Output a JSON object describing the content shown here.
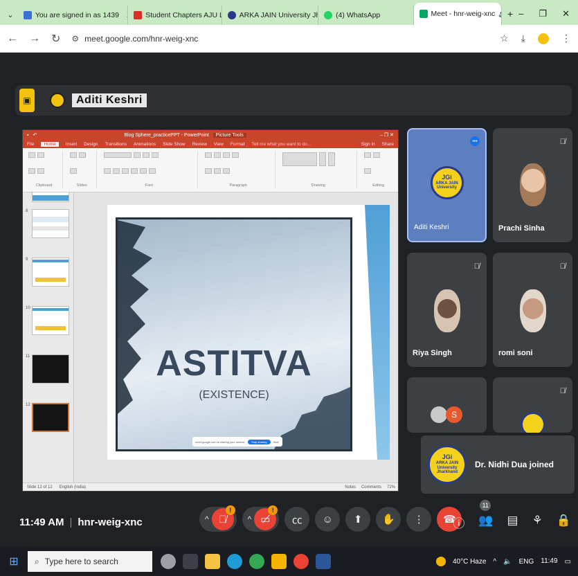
{
  "browser": {
    "tabs": [
      {
        "title": "You are signed in as 1439",
        "color": "#3a6fd8"
      },
      {
        "title": "Student Chapters AJU Logo",
        "color": "#d93025"
      },
      {
        "title": "ARKA JAIN University Jharkh",
        "color": "#2a3a8a"
      },
      {
        "title": "(4) WhatsApp",
        "color": "#25d366"
      },
      {
        "title": "Meet - hnr-weig-xnc",
        "color": "#00a862"
      }
    ],
    "tab_close": "X",
    "tab_new": "+",
    "url": "meet.google.com/hnr-weig-xnc"
  },
  "presenter": {
    "name": "Aditi Keshri"
  },
  "ppt": {
    "window_title": "Blog Sphere_practicePPT - PowerPoint",
    "context_tab": "Picture Tools",
    "menu": [
      "File",
      "Home",
      "Insert",
      "Design",
      "Transitions",
      "Animations",
      "Slide Show",
      "Review",
      "View",
      "Format"
    ],
    "tell_me": "Tell me what you want to do...",
    "sign_in": "Sign in",
    "share": "Share",
    "ribbon_groups": [
      "Clipboard",
      "Slides",
      "Font",
      "Paragraph",
      "Drawing",
      "Editing"
    ],
    "slide_numbers": [
      "8",
      "9",
      "10",
      "11",
      "12"
    ],
    "slide_title": "ASTITVA",
    "slide_subtitle": "(EXISTENCE)",
    "status_left": "Slide 12 of 12",
    "status_lang": "English (India)",
    "status_notes": "Notes",
    "status_comments": "Comments",
    "zoom": "72%",
    "sharing_toast": "meet.google.com is sharing your screen.",
    "stop_sharing": "Stop sharing",
    "hide": "Hide"
  },
  "tiles": [
    {
      "name": "Aditi Keshri",
      "kind": "logo",
      "active": true
    },
    {
      "name": "Prachi Sinha",
      "kind": "photo-a",
      "muted": true
    },
    {
      "name": "Riya Singh",
      "kind": "photo-b",
      "muted": true
    },
    {
      "name": "romi soni",
      "kind": "photo-c",
      "muted": true
    }
  ],
  "more_tile_initial": "S",
  "logo_text": {
    "mark": "JGi",
    "line1": "ARKA JAIN",
    "line2": "University",
    "line3": "Jharkhand"
  },
  "join_notice": "Dr. Nidhi Dua joined",
  "controls": {
    "time": "11:49 AM",
    "meeting_code": "hnr-weig-xnc",
    "people_count": "11",
    "warn": "!"
  },
  "taskbar": {
    "search_placeholder": "Type here to search",
    "weather": "40°C  Haze",
    "lang": "ENG",
    "time": "11:49"
  },
  "colors": {
    "meet_bg": "#202124",
    "tile_bg": "#3c4043",
    "end_call": "#ea4335",
    "ppt_red": "#c8442a"
  }
}
